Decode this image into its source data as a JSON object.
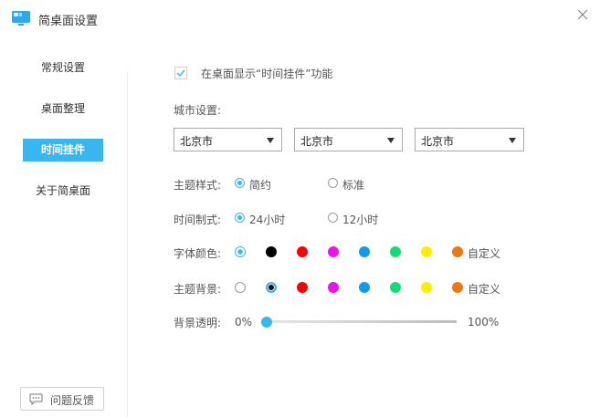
{
  "window": {
    "title": "简桌面设置",
    "close_label": "✕"
  },
  "sidebar": {
    "items": [
      {
        "label": "常规设置"
      },
      {
        "label": "桌面整理"
      },
      {
        "label": "时间挂件",
        "active": true
      },
      {
        "label": "关于简桌面"
      }
    ],
    "feedback_label": "问题反馈"
  },
  "main": {
    "enable_widget": {
      "label": "在桌面显示“时间挂件”功能",
      "checked": true
    },
    "city": {
      "label": "城市设置:",
      "selects": [
        {
          "value": "北京市"
        },
        {
          "value": "北京市"
        },
        {
          "value": "北京市"
        }
      ]
    },
    "theme_style": {
      "label": "主题样式:",
      "options": [
        {
          "label": "简约",
          "selected": true
        },
        {
          "label": "标准",
          "selected": false
        }
      ]
    },
    "time_format": {
      "label": "时间制式:",
      "options": [
        {
          "label": "24小时",
          "selected": true
        },
        {
          "label": "12小时",
          "selected": false
        }
      ]
    },
    "font_color": {
      "label": "字体颜色:",
      "custom_label": "自定义",
      "colors": [
        "#ffffff",
        "#000000",
        "#ff0000",
        "#ee11ee",
        "#1199ee",
        "#11dd77",
        "#ffee00",
        "#ee7711"
      ],
      "selected_index": 0
    },
    "theme_bg": {
      "label": "主题背景:",
      "custom_label": "自定义",
      "colors": [
        "#ffffff",
        "#000000",
        "#ff0000",
        "#ee11ee",
        "#1199ee",
        "#11dd77",
        "#ffee00",
        "#ee7711"
      ],
      "selected_index": 1
    },
    "bg_opacity": {
      "label": "背景透明:",
      "min_label": "0%",
      "max_label": "100%",
      "value_percent": 0
    }
  },
  "colors": {
    "accent": "#37b6f0"
  }
}
